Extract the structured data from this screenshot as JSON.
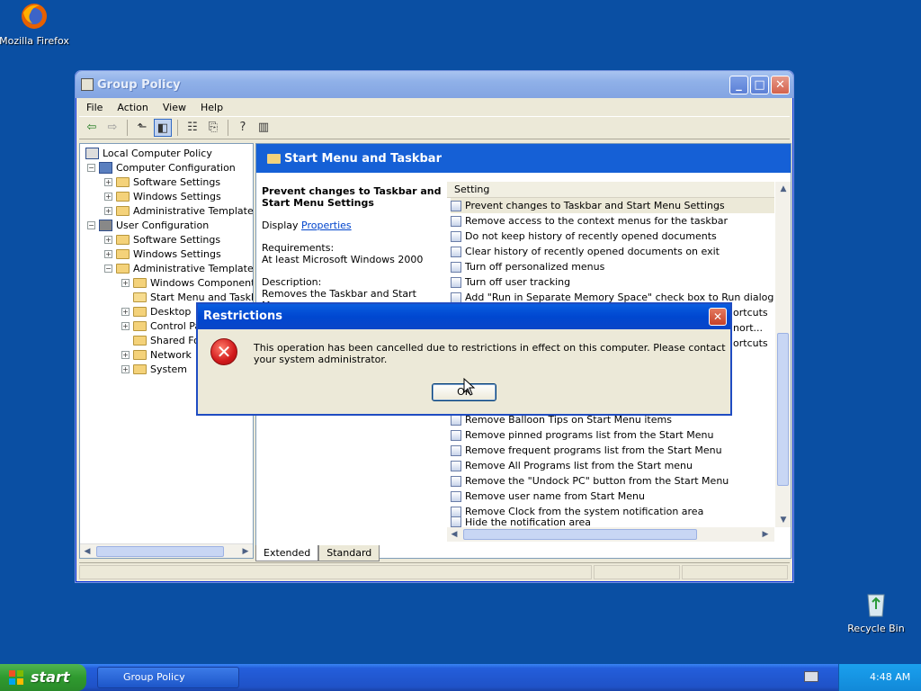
{
  "desktop": {
    "icons": [
      {
        "label": "Mozilla Firefox"
      },
      {
        "label": "Recycle Bin"
      }
    ]
  },
  "window": {
    "title": "Group Policy",
    "controls": {
      "minimize": "_",
      "maximize": "□",
      "close": "✕"
    },
    "menu": [
      "File",
      "Action",
      "View",
      "Help"
    ],
    "tree": {
      "root": "Local Computer Policy",
      "nodes": [
        "Computer Configuration",
        "Software Settings",
        "Windows Settings",
        "Administrative Templates",
        "User Configuration",
        "Software Settings",
        "Windows Settings",
        "Administrative Templates",
        "Windows Components",
        "Start Menu and Taskbar",
        "Desktop",
        "Control Pa",
        "Shared Fo",
        "Network",
        "System"
      ]
    },
    "right_header": "Start Menu and Taskbar",
    "description": {
      "title": "Prevent changes to Taskbar and Start Menu Settings",
      "display_label": "Display",
      "properties_link": "Properties",
      "requirements_label": "Requirements:",
      "requirements_value": "At least Microsoft Windows 2000",
      "description_label": "Description:",
      "description_value": "Removes the Taskbar and Start Menu"
    },
    "list": {
      "column_header": "Setting",
      "rows_top": [
        "Prevent changes to Taskbar and Start Menu Settings",
        "Remove access to the context menus for the taskbar",
        "Do not keep history of recently opened documents",
        "Clear history of recently opened documents on exit",
        "Turn off personalized menus",
        "Turn off user tracking",
        "Add \"Run in Separate Memory Space\" check box to Run dialog box"
      ],
      "rows_partial": [
        "ortcuts",
        "nort...",
        "ortcuts"
      ],
      "rows_bottom": [
        "Remove Balloon Tips on Start Menu items",
        "Remove pinned programs list from the Start Menu",
        "Remove frequent programs list from the Start Menu",
        "Remove All Programs list from the Start menu",
        "Remove the \"Undock PC\" button from the Start Menu",
        "Remove user name from Start Menu",
        "Remove Clock from the system notification area",
        "Hide the notification area"
      ]
    },
    "tabs": [
      "Extended",
      "Standard"
    ]
  },
  "dialog": {
    "title": "Restrictions",
    "close": "✕",
    "message": "This operation has been cancelled due to restrictions in effect on this computer. Please contact your system administrator.",
    "ok_label": "OK"
  },
  "taskbar": {
    "start_label": "start",
    "task_label": "Group Policy",
    "clock": "4:48 AM"
  }
}
